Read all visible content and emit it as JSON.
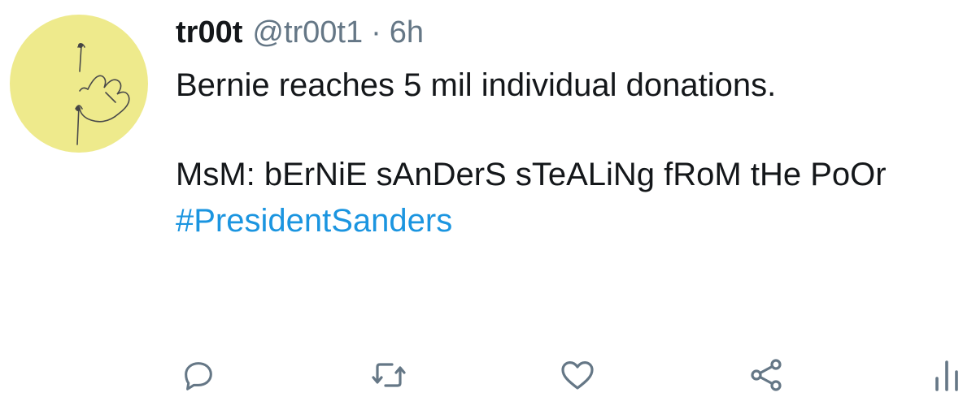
{
  "tweet": {
    "author_name": "tr00t",
    "author_handle": "@tr00t1",
    "separator": "·",
    "timestamp": "6h",
    "body_line_1": "Bernie reaches 5 mil individual donations.",
    "body_line_2": "MsM: bErNiE sAnDerS sTeALiNg fRoM tHe PoOr",
    "hashtag": "#PresidentSanders"
  },
  "icons": {
    "avatar": "avatar-hand-drawing",
    "reply": "reply-icon",
    "retweet": "retweet-icon",
    "like": "heart-icon",
    "share": "share-icon",
    "stats": "analytics-icon"
  },
  "colors": {
    "text": "#14171a",
    "muted": "#657786",
    "link": "#1b95e0",
    "avatar_bg": "#eeea8c"
  }
}
